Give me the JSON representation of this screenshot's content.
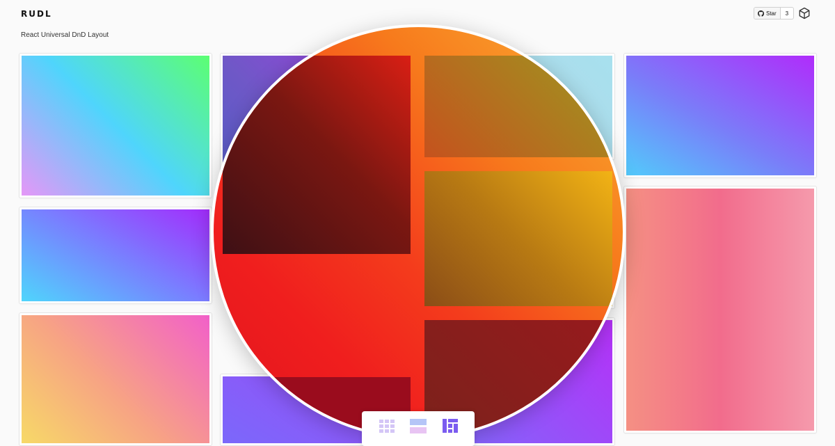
{
  "header": {
    "logo": "RUDL",
    "subtitle": "React Universal DnD Layout",
    "github": {
      "star_label": "Star",
      "star_count": "3",
      "icon": "github-icon"
    },
    "sandbox_icon": "codesandbox-cube-icon"
  },
  "toolbar": {
    "buttons": [
      {
        "name": "grid-layout",
        "icon": "grid-icon"
      },
      {
        "name": "list-layout",
        "icon": "list-icon"
      },
      {
        "name": "masonry-layout",
        "icon": "masonry-icon"
      }
    ]
  },
  "colors": {
    "background": "#fafafa",
    "lens_gradient": [
      "#fbb034",
      "#f01e1e"
    ],
    "accent_purple": "#7b5cf0"
  }
}
